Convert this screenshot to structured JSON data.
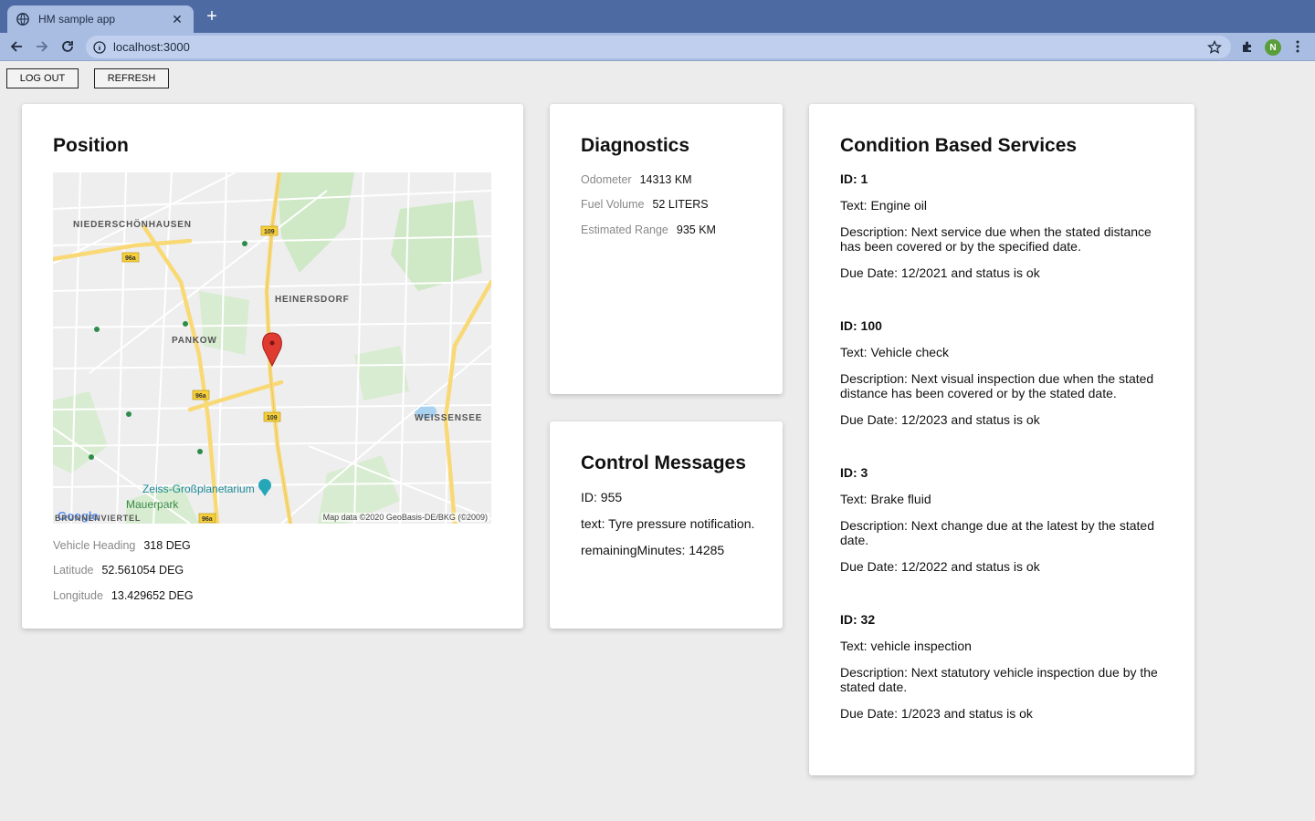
{
  "browser": {
    "tab_title": "HM sample app",
    "tab_close": "✕",
    "new_tab": "+",
    "url": "localhost:3000",
    "profile_initial": "N"
  },
  "actions": {
    "logout_label": "LOG OUT",
    "refresh_label": "REFRESH"
  },
  "position": {
    "title": "Position",
    "map": {
      "labels": {
        "niederschonhausen": "NIEDERSCHÖNHAUSEN",
        "heinersdorf": "HEINERSDORF",
        "pankow": "PANKOW",
        "weissensee": "WEISSENSEE",
        "zeiss": "Zeiss-Großplanetarium",
        "mauerpark": "Mauerpark",
        "viertel": "BRUNNENVIERTEL"
      },
      "credit": "Map data ©2020 GeoBasis-DE/BKG (©2009)",
      "google": "Google"
    },
    "heading_label": "Vehicle Heading",
    "heading_value": "318 DEG",
    "latitude_label": "Latitude",
    "latitude_value": "52.561054 DEG",
    "longitude_label": "Longitude",
    "longitude_value": "13.429652 DEG"
  },
  "diagnostics": {
    "title": "Diagnostics",
    "odometer_label": "Odometer",
    "odometer_value": "14313 KM",
    "fuel_label": "Fuel Volume",
    "fuel_value": "52 LITERS",
    "range_label": "Estimated Range",
    "range_value": "935 KM"
  },
  "control_messages": {
    "title": "Control Messages",
    "id": "ID: 955",
    "text": "text: Tyre pressure notification.",
    "remaining": "remainingMinutes: 14285"
  },
  "cbs": {
    "title": "Condition Based Services",
    "items": [
      {
        "id": "ID: 1",
        "text": "Text: Engine oil",
        "description": "Description: Next service due when the stated distance has been covered or by the specified date.",
        "due": "Due Date: 12/2021 and status is ok"
      },
      {
        "id": "ID: 100",
        "text": "Text: Vehicle check",
        "description": "Description: Next visual inspection due when the stated distance has been covered or by the stated date.",
        "due": "Due Date: 12/2023 and status is ok"
      },
      {
        "id": "ID: 3",
        "text": "Text: Brake fluid",
        "description": "Description: Next change due at the latest by the stated date.",
        "due": "Due Date: 12/2022 and status is ok"
      },
      {
        "id": "ID: 32",
        "text": "Text: vehicle inspection",
        "description": "Description: Next statutory vehicle inspection due by the stated date.",
        "due": "Due Date: 1/2023 and status is ok"
      }
    ]
  }
}
